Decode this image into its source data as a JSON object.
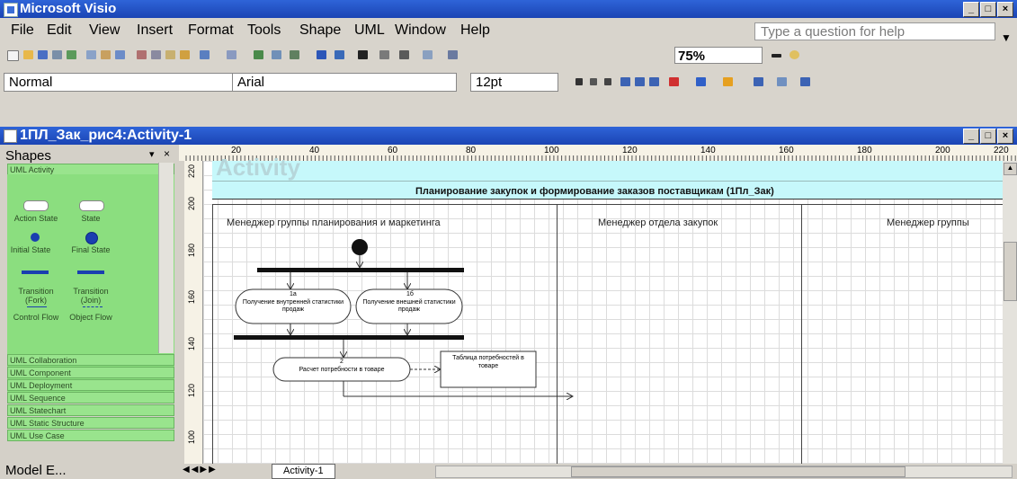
{
  "app": {
    "title": "Microsoft Visio",
    "window_buttons": [
      "_",
      "□",
      "×"
    ]
  },
  "menu": {
    "items": [
      "File",
      "Edit",
      "View",
      "Insert",
      "Format",
      "Tools",
      "Shape",
      "UML",
      "Window",
      "Help"
    ],
    "help_placeholder": "Type a question for help"
  },
  "toolbar": {
    "zoom": "75%"
  },
  "format_toolbar": {
    "style": "Normal",
    "font": "Arial",
    "size": "12pt"
  },
  "document": {
    "title": "1ПЛ_Зак_рис4:Activity-1"
  },
  "shapes_panel": {
    "header": "Shapes",
    "active_stencil": "UML Activity",
    "shapes": [
      {
        "label": "Action State",
        "icon": "action-state-icon"
      },
      {
        "label": "State",
        "icon": "state-icon"
      },
      {
        "label": "Initial State",
        "icon": "initial-state-icon"
      },
      {
        "label": "Final State",
        "icon": "final-state-icon"
      },
      {
        "label": "Transition (Fork)",
        "icon": "fork-icon"
      },
      {
        "label": "Transition (Join)",
        "icon": "join-icon"
      },
      {
        "label": "Control Flow",
        "icon": "control-flow-icon"
      },
      {
        "label": "Object Flow",
        "icon": "object-flow-icon"
      }
    ],
    "stencils": [
      "UML Collaboration",
      "UML Component",
      "UML Deployment",
      "UML Sequence",
      "UML Statechart",
      "UML Static Structure",
      "UML Use Case"
    ],
    "model_explorer": "Model E..."
  },
  "ruler": {
    "h_ticks": [
      "20",
      "40",
      "60",
      "80",
      "100",
      "120",
      "140",
      "160",
      "180",
      "200",
      "220"
    ],
    "v_ticks": [
      "220",
      "200",
      "180",
      "160",
      "140",
      "120",
      "100"
    ]
  },
  "diagram": {
    "header_text": "Activity",
    "title": "Планирование закупок и формирование заказов поставщикам (1Пл_Зак)",
    "lanes": [
      "Менеджер группы планирования и маркетинга",
      "Менеджер отдела закупок",
      "Менеджер группы"
    ],
    "activity_1a_num": "1а",
    "activity_1a": "Получение внутренней статистики продаж",
    "activity_1b_num": "1б",
    "activity_1b": "Получение внешней статистики продаж",
    "activity_2_num": "2",
    "activity_2": "Расчет потребности в товаре",
    "object_node": "Таблица потребностей в товаре"
  },
  "sheet_tab": "Activity-1",
  "colors": {
    "title_bar": "#1f4ec0",
    "stencil_green": "#8bde7f",
    "swimlane_header": "#c6f8fb",
    "chrome": "#d8d4cc"
  }
}
